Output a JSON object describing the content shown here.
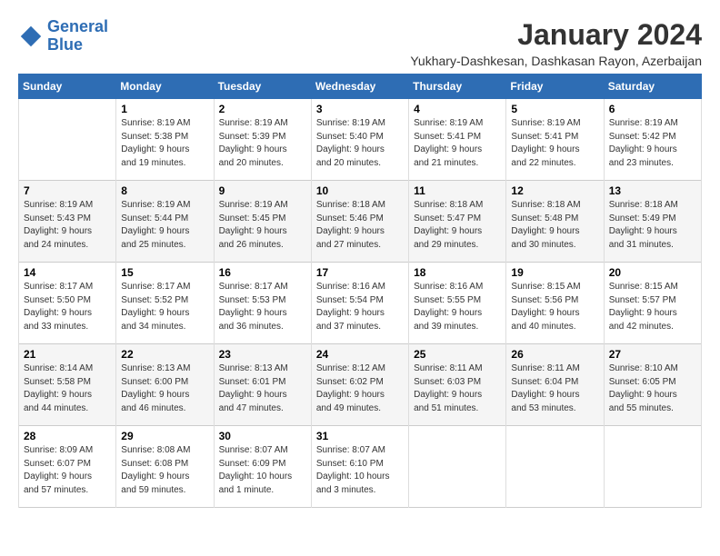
{
  "logo": {
    "line1": "General",
    "line2": "Blue"
  },
  "title": "January 2024",
  "location": "Yukhary-Dashkesan, Dashkasan Rayon, Azerbaijan",
  "days_header": [
    "Sunday",
    "Monday",
    "Tuesday",
    "Wednesday",
    "Thursday",
    "Friday",
    "Saturday"
  ],
  "weeks": [
    [
      {
        "day": "",
        "info": ""
      },
      {
        "day": "1",
        "info": "Sunrise: 8:19 AM\nSunset: 5:38 PM\nDaylight: 9 hours\nand 19 minutes."
      },
      {
        "day": "2",
        "info": "Sunrise: 8:19 AM\nSunset: 5:39 PM\nDaylight: 9 hours\nand 20 minutes."
      },
      {
        "day": "3",
        "info": "Sunrise: 8:19 AM\nSunset: 5:40 PM\nDaylight: 9 hours\nand 20 minutes."
      },
      {
        "day": "4",
        "info": "Sunrise: 8:19 AM\nSunset: 5:41 PM\nDaylight: 9 hours\nand 21 minutes."
      },
      {
        "day": "5",
        "info": "Sunrise: 8:19 AM\nSunset: 5:41 PM\nDaylight: 9 hours\nand 22 minutes."
      },
      {
        "day": "6",
        "info": "Sunrise: 8:19 AM\nSunset: 5:42 PM\nDaylight: 9 hours\nand 23 minutes."
      }
    ],
    [
      {
        "day": "7",
        "info": "Sunrise: 8:19 AM\nSunset: 5:43 PM\nDaylight: 9 hours\nand 24 minutes."
      },
      {
        "day": "8",
        "info": "Sunrise: 8:19 AM\nSunset: 5:44 PM\nDaylight: 9 hours\nand 25 minutes."
      },
      {
        "day": "9",
        "info": "Sunrise: 8:19 AM\nSunset: 5:45 PM\nDaylight: 9 hours\nand 26 minutes."
      },
      {
        "day": "10",
        "info": "Sunrise: 8:18 AM\nSunset: 5:46 PM\nDaylight: 9 hours\nand 27 minutes."
      },
      {
        "day": "11",
        "info": "Sunrise: 8:18 AM\nSunset: 5:47 PM\nDaylight: 9 hours\nand 29 minutes."
      },
      {
        "day": "12",
        "info": "Sunrise: 8:18 AM\nSunset: 5:48 PM\nDaylight: 9 hours\nand 30 minutes."
      },
      {
        "day": "13",
        "info": "Sunrise: 8:18 AM\nSunset: 5:49 PM\nDaylight: 9 hours\nand 31 minutes."
      }
    ],
    [
      {
        "day": "14",
        "info": "Sunrise: 8:17 AM\nSunset: 5:50 PM\nDaylight: 9 hours\nand 33 minutes."
      },
      {
        "day": "15",
        "info": "Sunrise: 8:17 AM\nSunset: 5:52 PM\nDaylight: 9 hours\nand 34 minutes."
      },
      {
        "day": "16",
        "info": "Sunrise: 8:17 AM\nSunset: 5:53 PM\nDaylight: 9 hours\nand 36 minutes."
      },
      {
        "day": "17",
        "info": "Sunrise: 8:16 AM\nSunset: 5:54 PM\nDaylight: 9 hours\nand 37 minutes."
      },
      {
        "day": "18",
        "info": "Sunrise: 8:16 AM\nSunset: 5:55 PM\nDaylight: 9 hours\nand 39 minutes."
      },
      {
        "day": "19",
        "info": "Sunrise: 8:15 AM\nSunset: 5:56 PM\nDaylight: 9 hours\nand 40 minutes."
      },
      {
        "day": "20",
        "info": "Sunrise: 8:15 AM\nSunset: 5:57 PM\nDaylight: 9 hours\nand 42 minutes."
      }
    ],
    [
      {
        "day": "21",
        "info": "Sunrise: 8:14 AM\nSunset: 5:58 PM\nDaylight: 9 hours\nand 44 minutes."
      },
      {
        "day": "22",
        "info": "Sunrise: 8:13 AM\nSunset: 6:00 PM\nDaylight: 9 hours\nand 46 minutes."
      },
      {
        "day": "23",
        "info": "Sunrise: 8:13 AM\nSunset: 6:01 PM\nDaylight: 9 hours\nand 47 minutes."
      },
      {
        "day": "24",
        "info": "Sunrise: 8:12 AM\nSunset: 6:02 PM\nDaylight: 9 hours\nand 49 minutes."
      },
      {
        "day": "25",
        "info": "Sunrise: 8:11 AM\nSunset: 6:03 PM\nDaylight: 9 hours\nand 51 minutes."
      },
      {
        "day": "26",
        "info": "Sunrise: 8:11 AM\nSunset: 6:04 PM\nDaylight: 9 hours\nand 53 minutes."
      },
      {
        "day": "27",
        "info": "Sunrise: 8:10 AM\nSunset: 6:05 PM\nDaylight: 9 hours\nand 55 minutes."
      }
    ],
    [
      {
        "day": "28",
        "info": "Sunrise: 8:09 AM\nSunset: 6:07 PM\nDaylight: 9 hours\nand 57 minutes."
      },
      {
        "day": "29",
        "info": "Sunrise: 8:08 AM\nSunset: 6:08 PM\nDaylight: 9 hours\nand 59 minutes."
      },
      {
        "day": "30",
        "info": "Sunrise: 8:07 AM\nSunset: 6:09 PM\nDaylight: 10 hours\nand 1 minute."
      },
      {
        "day": "31",
        "info": "Sunrise: 8:07 AM\nSunset: 6:10 PM\nDaylight: 10 hours\nand 3 minutes."
      },
      {
        "day": "",
        "info": ""
      },
      {
        "day": "",
        "info": ""
      },
      {
        "day": "",
        "info": ""
      }
    ]
  ]
}
